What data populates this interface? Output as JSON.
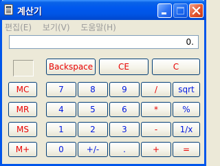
{
  "window": {
    "title": "계산기",
    "accent": "#0055EA",
    "face_color": "#ECE9D8"
  },
  "menubar": {
    "items": [
      {
        "label": "편집(E)"
      },
      {
        "label": "보기(V)"
      },
      {
        "label": "도움말(H)"
      }
    ]
  },
  "display": {
    "value": "0."
  },
  "memory_indicator": {
    "value": ""
  },
  "control_keys": {
    "backspace": "Backspace",
    "ce": "CE",
    "c": "C"
  },
  "memory_keys": {
    "mc": "MC",
    "mr": "MR",
    "ms": "MS",
    "mplus": "M+"
  },
  "keypad": {
    "rows": [
      [
        "7",
        "8",
        "9",
        "/",
        "sqrt"
      ],
      [
        "4",
        "5",
        "6",
        "*",
        "%"
      ],
      [
        "1",
        "2",
        "3",
        "-",
        "1/x"
      ],
      [
        "0",
        "+/-",
        ".",
        "+",
        "="
      ]
    ]
  },
  "colors": {
    "operator_red": "#E80000",
    "digit_blue": "#0018E0"
  }
}
